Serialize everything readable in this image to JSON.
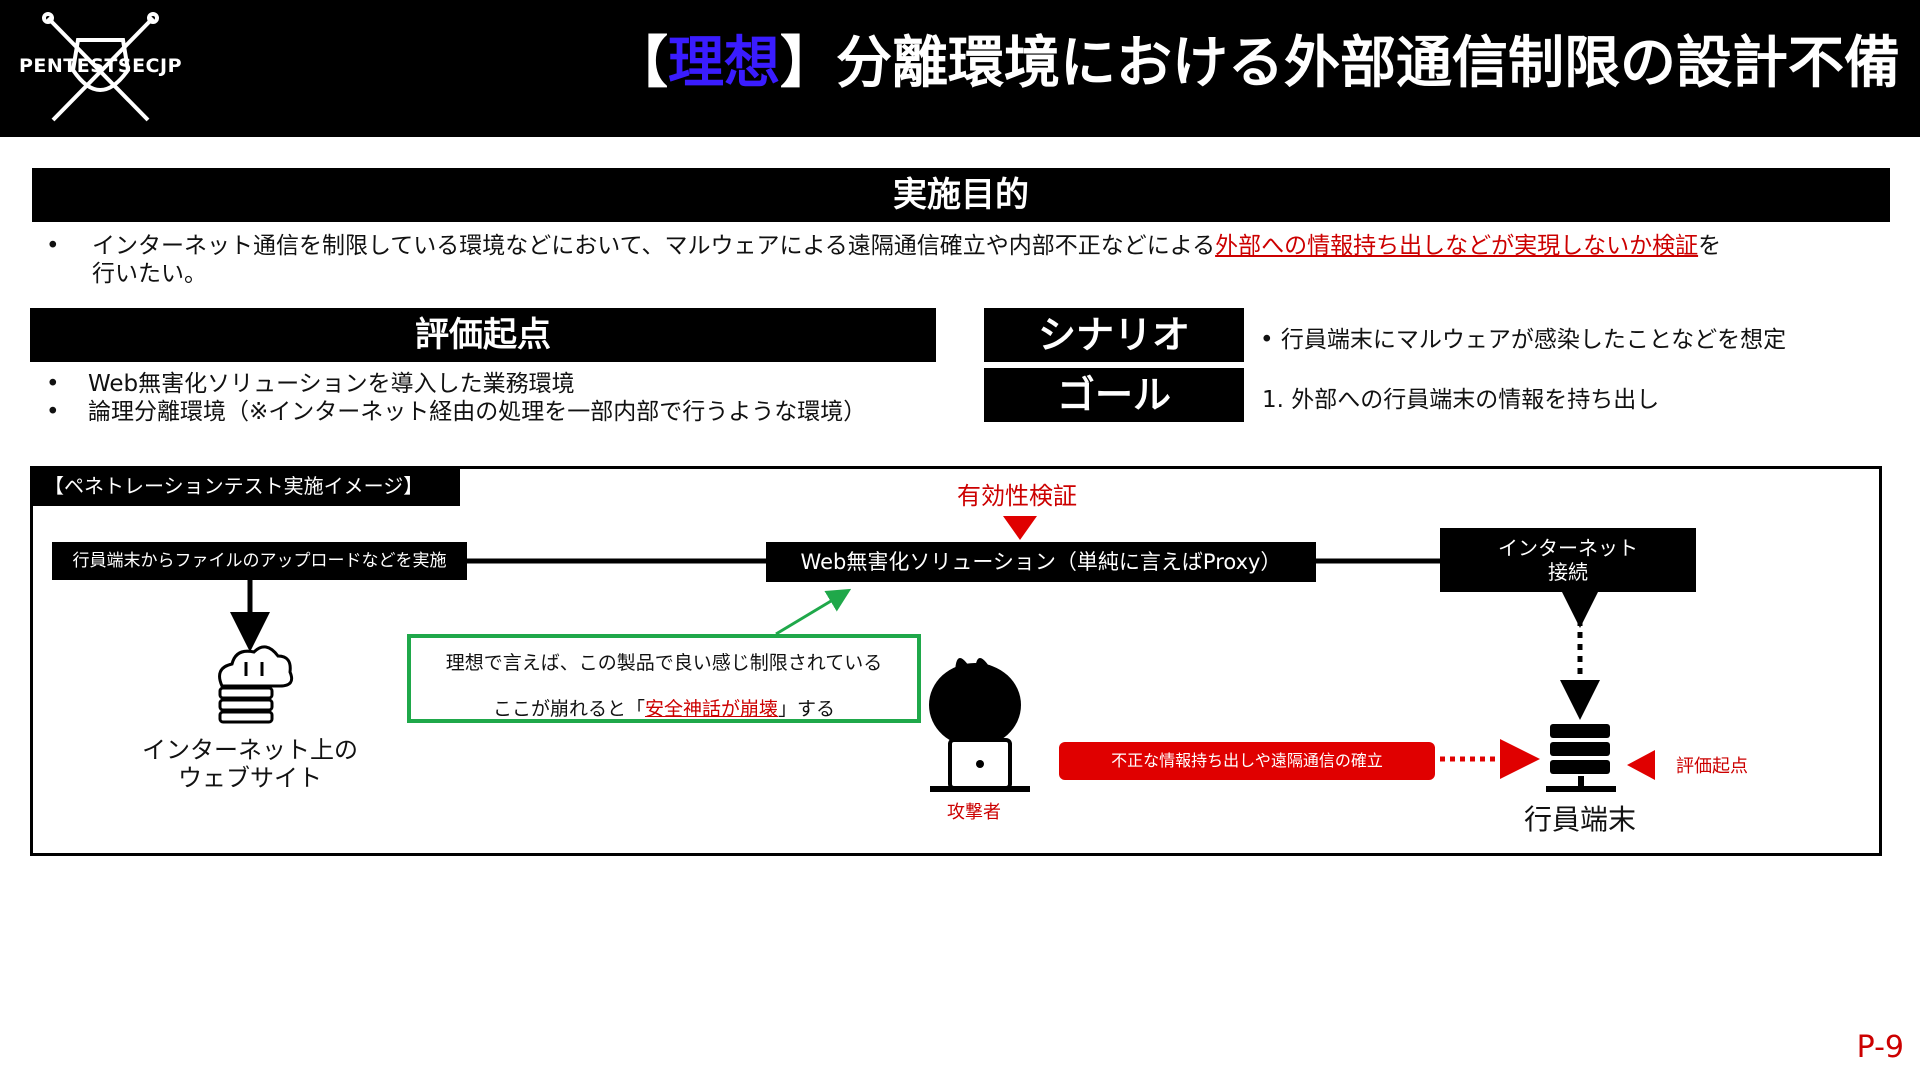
{
  "header": {
    "logo_text": "PENTESTSECJP",
    "title_bracket_open": "【",
    "title_highlight": "理想",
    "title_bracket_close": "】",
    "title_rest": "分離環境における外部通信制限の設計不備"
  },
  "purpose": {
    "heading": "実施目的",
    "bullet": "•",
    "text_before": "インターネット通信を制限している環境などにおいて、マルウェアによる遠隔通信確立や内部不正などによる",
    "text_highlight": "外部への情報持ち出しなどが実現しないか検証",
    "text_after": "を",
    "text_line2": "行いたい。"
  },
  "evaluation": {
    "heading": "評価起点",
    "items": [
      "Web無害化ソリューションを導入した業務環境",
      "論理分離環境（※インターネット経由の処理を一部内部で行うような環境）"
    ]
  },
  "scenario": {
    "label": "シナリオ",
    "text": "• 行員端末にマルウェアが感染したことなどを想定"
  },
  "goal": {
    "label": "ゴール",
    "text": "1. 外部への行員端末の情報を持ち出し"
  },
  "diagram": {
    "label": "【ペネトレーションテスト実施イメージ】",
    "upload_box": "行員端末からファイルのアップロードなどを実施",
    "web_solution": "Web無害化ソリューション（単純に言えばProxy）",
    "internet_line1": "インターネット",
    "internet_line2": "接続",
    "verify": "有効性検証",
    "ideal_line1": "理想で言えば、この製品で良い感じ制限されている",
    "ideal_line2_before": "ここが崩れると「",
    "ideal_line2_highlight": "安全神話が崩壊",
    "ideal_line2_after": "」する",
    "website_line1": "インターネット上の",
    "website_line2": "ウェブサイト",
    "attacker": "攻撃者",
    "leak": "不正な情報持ち出しや遠隔通信の確立",
    "terminal": "行員端末",
    "eval_start": "評価起点",
    "icons": [
      "cloud-server-icon",
      "hacker-icon",
      "server-icon"
    ],
    "colors": {
      "accent_red": "#e00000",
      "ideal_green": "#1fa84a",
      "title_blue": "#3a1cff"
    }
  },
  "page_number": "P-9"
}
